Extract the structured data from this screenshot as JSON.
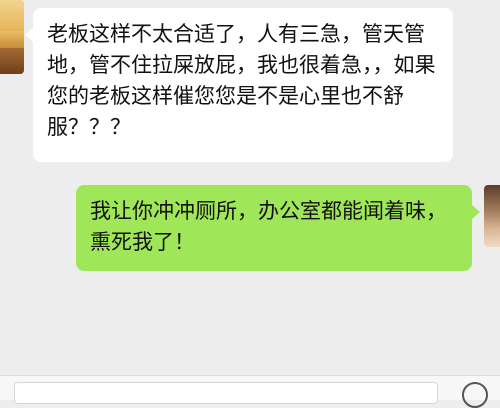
{
  "messages": [
    {
      "side": "left",
      "text": "老板这样不太合适了，人有三急，管天管地，管不住拉屎放屁，我也很着急，，如果您的老板这样催您您是不是心里也不舒服？？？"
    },
    {
      "side": "right",
      "text": "我让你冲冲厕所，办公室都能闻着味，熏死我了！"
    }
  ],
  "colors": {
    "background": "#ededed",
    "incoming_bubble": "#ffffff",
    "outgoing_bubble": "#9fe658"
  },
  "icons": {
    "contact_avatar": "avatar",
    "self_avatar": "avatar",
    "emoji": "smiley-icon"
  }
}
